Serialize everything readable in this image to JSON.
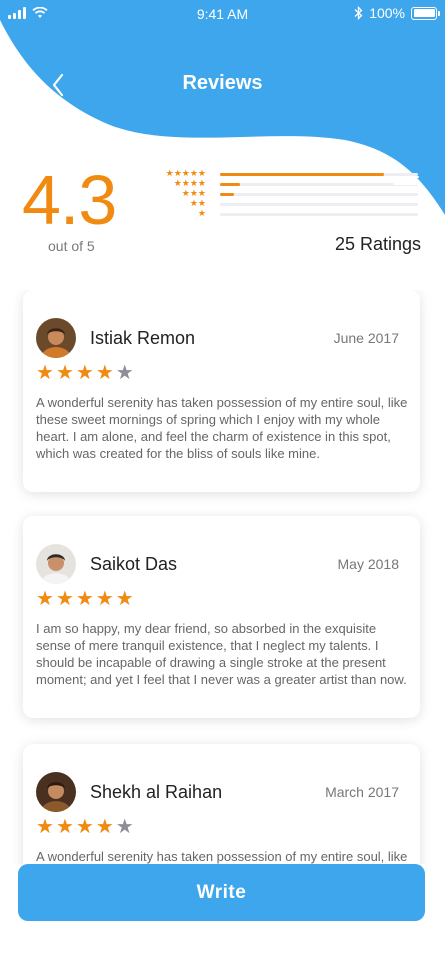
{
  "status_bar": {
    "time": "9:41 AM",
    "battery": "100%"
  },
  "nav": {
    "title": "Reviews",
    "back_icon": "chevron-left-icon"
  },
  "summary": {
    "average": "4.3",
    "out_of": "out of 5",
    "total": "25 Ratings",
    "distribution": [
      {
        "stars": 5,
        "label": "★★★★★",
        "fraction": 0.83
      },
      {
        "stars": 4,
        "label": "★★★★",
        "fraction": 0.1
      },
      {
        "stars": 3,
        "label": "★★★",
        "fraction": 0.07
      },
      {
        "stars": 2,
        "label": "★★",
        "fraction": 0.0
      },
      {
        "stars": 1,
        "label": "★",
        "fraction": 0.0
      }
    ]
  },
  "reviews": [
    {
      "name": "Istiak Remon",
      "date": "June 2017",
      "rating": 4,
      "text": "A wonderful serenity has taken possession of my entire soul, like these sweet mornings of spring which I enjoy with my whole heart. I am alone, and feel the charm of existence in this spot, which was created for the bliss of souls like mine."
    },
    {
      "name": "Saikot Das",
      "date": "May 2018",
      "rating": 5,
      "text": "I am so happy, my dear friend, so absorbed in the exquisite sense of mere tranquil existence, that I neglect my talents. I should be incapable of drawing a single stroke at the present moment; and yet I feel that I never was a greater artist than now."
    },
    {
      "name": "Shekh al Raihan",
      "date": "March 2017",
      "rating": 4,
      "text": "A wonderful serenity has taken possession of my entire soul, like these sweet mornings of spring which I enjoy with my whole heart. I am alone, and feel the charm of existence in this spot, which was created for the bliss of souls like mine."
    }
  ],
  "write_button": "Write",
  "colors": {
    "accent": "#3ea6ec",
    "star": "#f08a10",
    "star_off": "#8e8f96"
  }
}
